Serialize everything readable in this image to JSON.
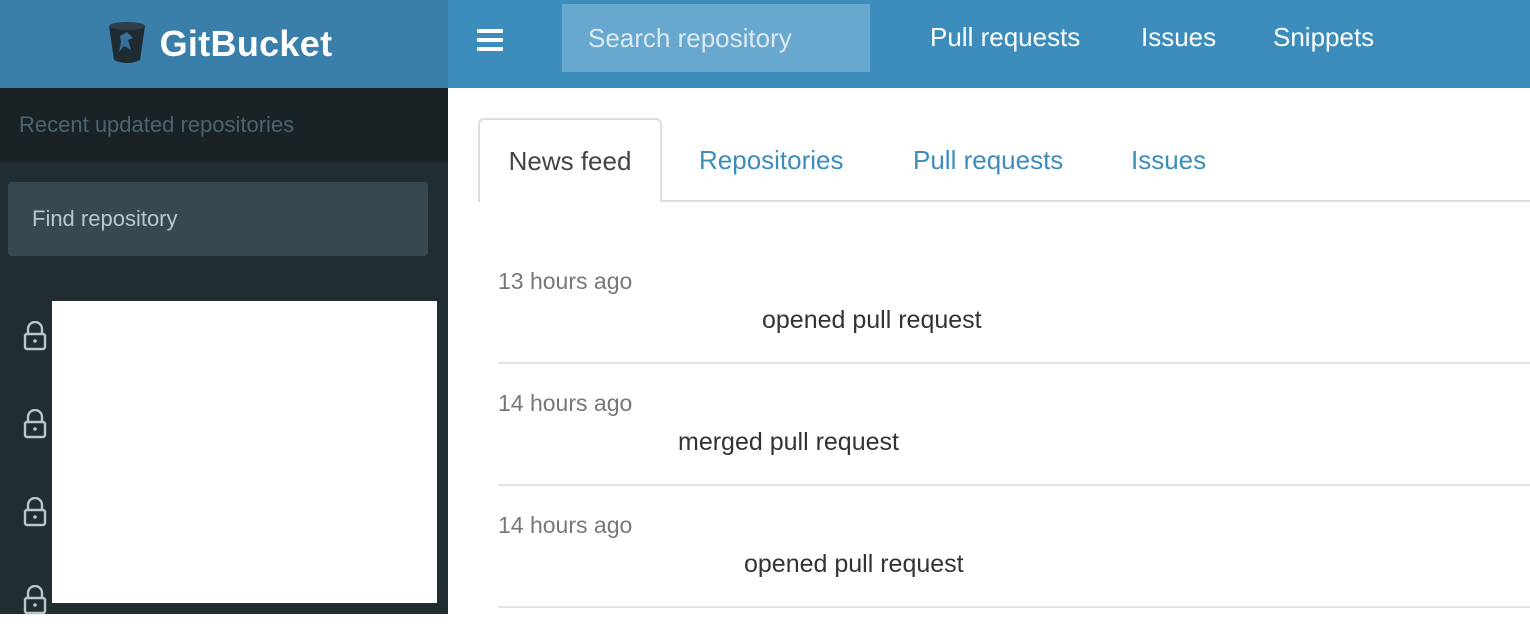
{
  "brand": {
    "title": "GitBucket",
    "icon": "bucket-logo-icon"
  },
  "topnav": {
    "menu_icon": "hamburger-icon",
    "search_placeholder": "Search repository",
    "links": [
      "Pull requests",
      "Issues",
      "Snippets"
    ]
  },
  "sidebar": {
    "header": "Recent updated repositories",
    "find_placeholder": "Find repository",
    "repo_icon": "lock-icon",
    "repo_count": 4
  },
  "tabs": [
    {
      "label": "News feed",
      "active": true
    },
    {
      "label": "Repositories",
      "active": false
    },
    {
      "label": "Pull requests",
      "active": false
    },
    {
      "label": "Issues",
      "active": false
    }
  ],
  "feed": [
    {
      "time": "13 hours ago",
      "action": "opened pull request"
    },
    {
      "time": "14 hours ago",
      "action": "merged pull request"
    },
    {
      "time": "14 hours ago",
      "action": "opened pull request"
    }
  ],
  "colors": {
    "brand_bar": "#3a7eaa",
    "topnav": "#3c8dbc",
    "sidebar": "#222d32",
    "sidebar_header": "#1a2226",
    "link": "#3c8dbc"
  }
}
